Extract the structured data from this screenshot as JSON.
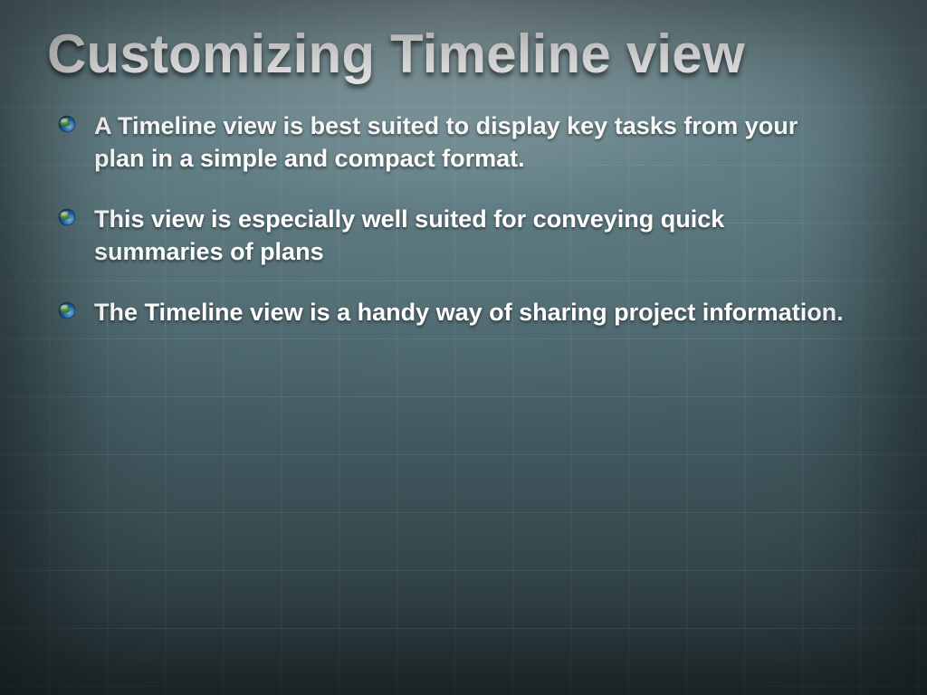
{
  "slide": {
    "title": "Customizing Timeline view",
    "bullets": [
      "A Timeline view is best suited to display key tasks from your plan in a simple and compact format.",
      "This view is especially well suited for conveying quick summaries of plans",
      "The Timeline view is a handy way of sharing project information."
    ],
    "colors": {
      "background_top": "#6d8a90",
      "background_bottom": "#2b3a3e",
      "text": "#ffffff"
    }
  }
}
